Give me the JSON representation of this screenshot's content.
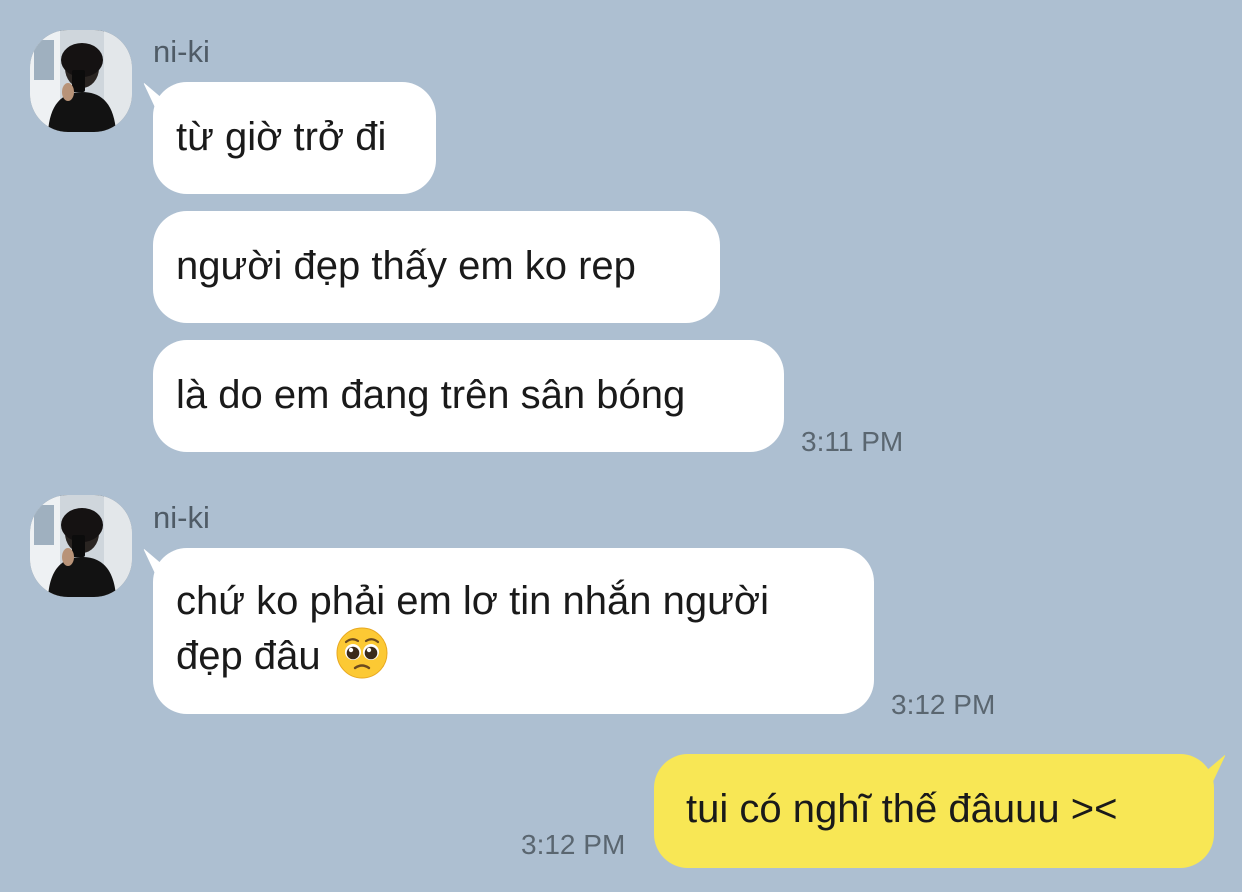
{
  "messages": [
    {
      "sender": "ni-ki",
      "lines": [
        "từ giờ trở đi",
        "người đẹp thấy em ko rep",
        "là do em đang trên sân bóng"
      ],
      "time": "3:11 PM"
    },
    {
      "sender": "ni-ki",
      "text_line1": "chứ ko phải em lơ tin nhắn người",
      "text_line2": "đẹp đâu",
      "emoji": "pleading-face",
      "time": "3:12 PM"
    },
    {
      "sender": "me",
      "text": "tui có nghĩ thế đâuuu ><",
      "time": "3:12 PM"
    }
  ],
  "colors": {
    "background": "#adbfd1",
    "incoming_bubble": "#ffffff",
    "outgoing_bubble": "#f8e755"
  }
}
